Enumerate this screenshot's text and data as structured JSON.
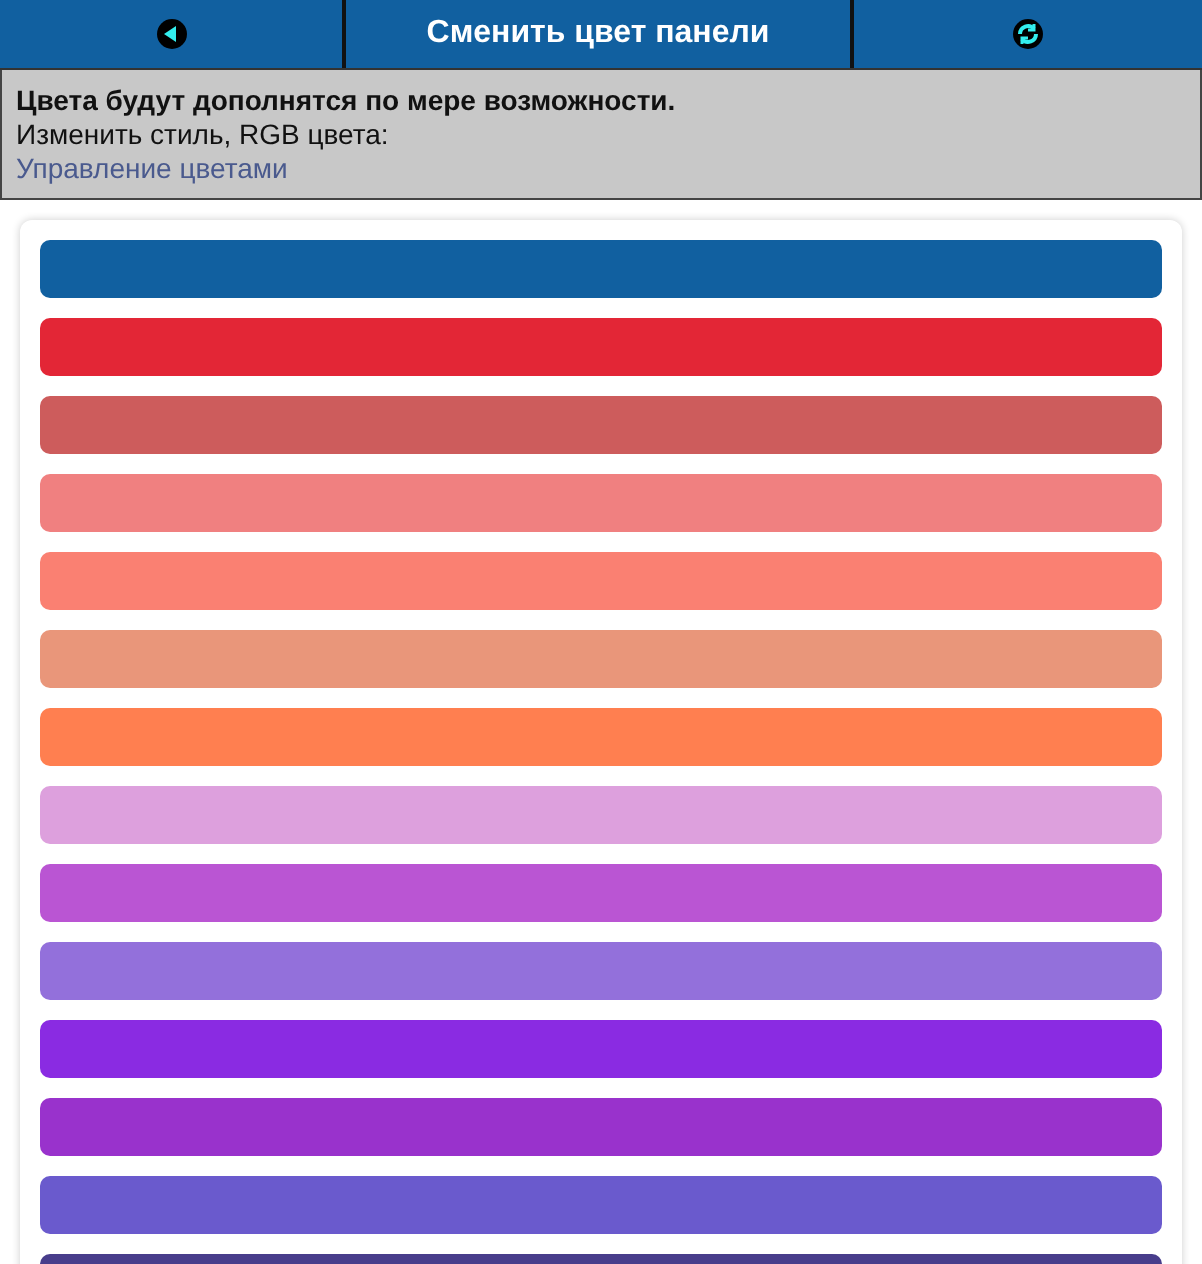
{
  "header": {
    "title": "Сменить цвет панели"
  },
  "info": {
    "heading": "Цвета будут дополнятся по мере возможности.",
    "text": "Изменить стиль, RGB цвета:",
    "link": "Управление цветами"
  },
  "swatches": [
    {
      "color": "#1160a0"
    },
    {
      "color": "#e32636"
    },
    {
      "color": "#cd5c5c"
    },
    {
      "color": "#f08080"
    },
    {
      "color": "#fa8072"
    },
    {
      "color": "#e9967a"
    },
    {
      "color": "#ff7f50"
    },
    {
      "color": "#dda0dd"
    },
    {
      "color": "#ba55d3"
    },
    {
      "color": "#9370db"
    },
    {
      "color": "#8a2be2"
    },
    {
      "color": "#9932cc"
    },
    {
      "color": "#6a5acd"
    },
    {
      "color": "#483d8b"
    }
  ]
}
